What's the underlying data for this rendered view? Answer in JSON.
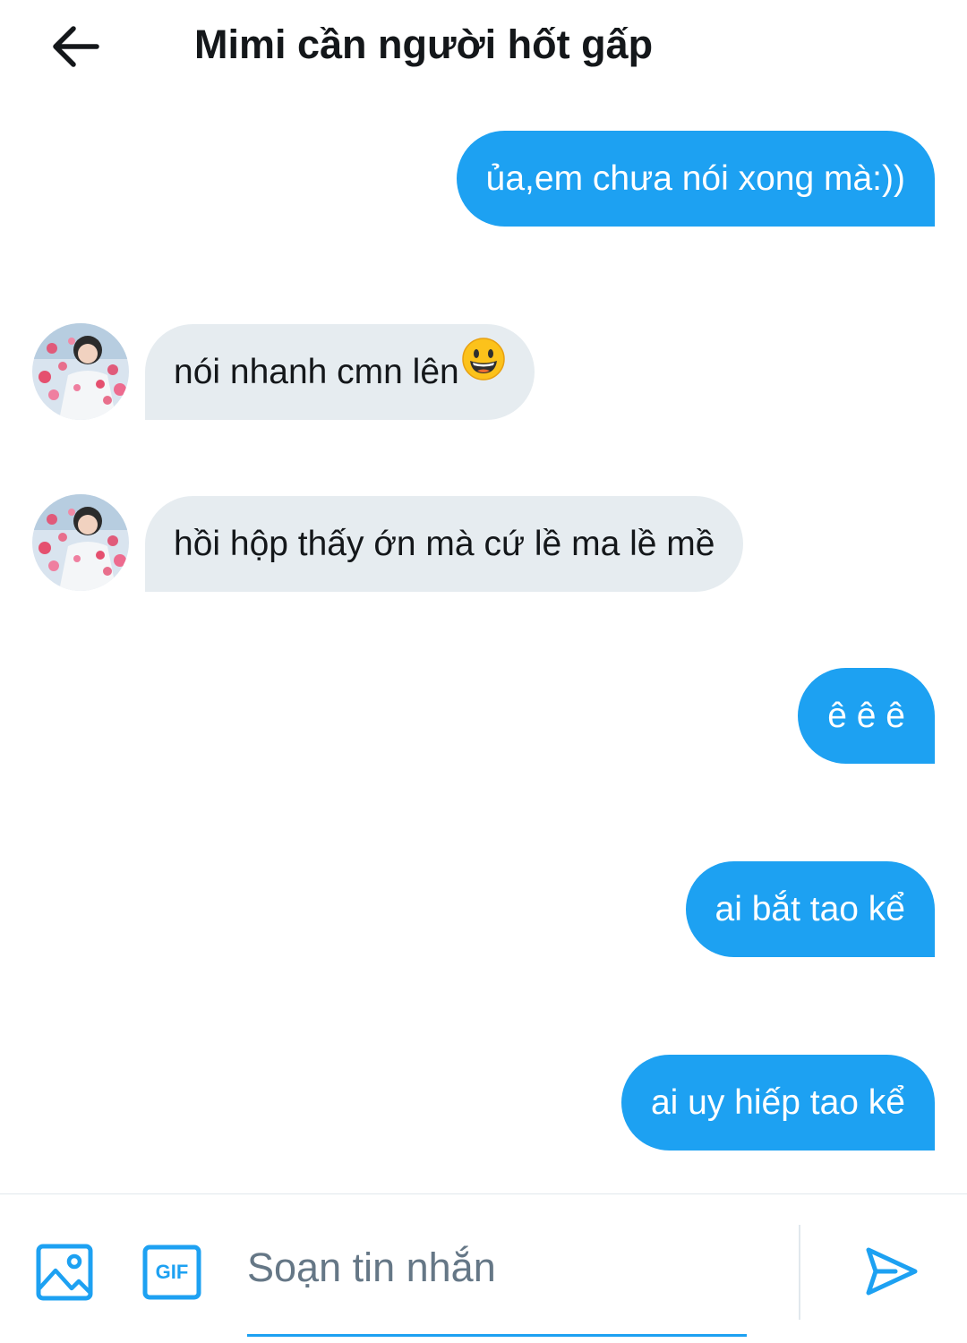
{
  "header": {
    "back_icon": "arrow-left-icon",
    "title": "Mimi cần người hốt gấp"
  },
  "messages": [
    {
      "side": "out",
      "text": "ủa,em chưa nói xong mà:))"
    },
    {
      "side": "in",
      "text": "nói nhanh cmn lên",
      "emoji": "grinning-face-emoji"
    },
    {
      "side": "in",
      "text": "hồi hộp thấy ớn mà cứ lề ma lề mề"
    },
    {
      "side": "out",
      "text": "ê ê ê"
    },
    {
      "side": "out",
      "text": "ai bắt tao kể"
    },
    {
      "side": "out",
      "text": "ai uy hiếp tao kể"
    }
  ],
  "composer": {
    "image_icon": "image-icon",
    "gif_icon": "gif-icon",
    "gif_label": "GIF",
    "placeholder": "Soạn tin nhắn",
    "send_icon": "send-icon"
  },
  "colors": {
    "accent": "#1da1f2",
    "incoming_bubble": "#e6ecf0",
    "text": "#14171a",
    "placeholder": "#657786"
  }
}
